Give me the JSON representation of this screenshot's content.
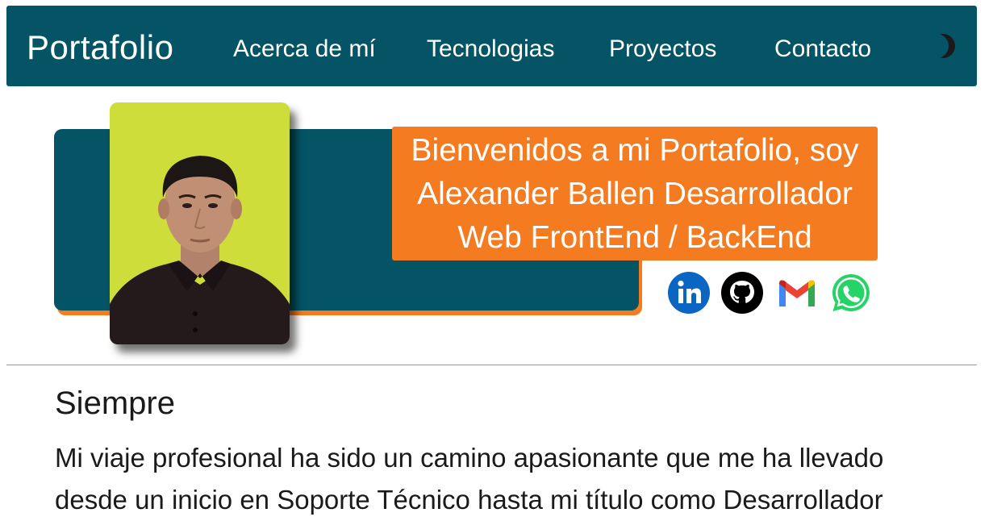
{
  "navbar": {
    "brand": "Portafolio",
    "links": [
      "Acerca de mí",
      "Tecnologias",
      "Proyectos",
      "Contacto"
    ],
    "theme_toggle_icon": "moon-icon",
    "background": "#045465"
  },
  "hero": {
    "welcome_lines": [
      "Bienvenidos a mi Portafolio, soy",
      "Alexander Ballen Desarrollador",
      "Web FrontEnd / BackEnd"
    ],
    "accent_color": "#f47b20",
    "photo_background": "#cedd39",
    "social_icons": [
      "linkedin-icon",
      "github-icon",
      "gmail-icon",
      "whatsapp-icon"
    ]
  },
  "about": {
    "title": "Siempre",
    "paragraph": "Mi viaje profesional ha sido un camino apasionante que me ha llevado desde un inicio en Soporte Técnico hasta mi título como Desarrollador"
  }
}
